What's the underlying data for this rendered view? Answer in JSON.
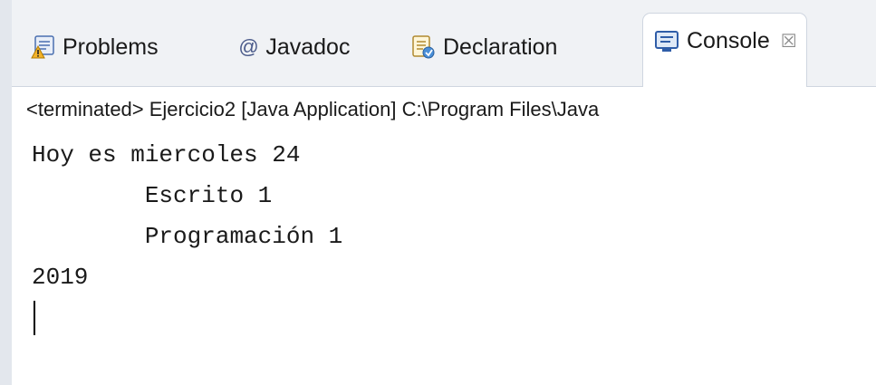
{
  "tabs": [
    {
      "label": "Problems",
      "icon": "problems-icon"
    },
    {
      "label": "Javadoc",
      "icon": "at-sign-icon",
      "glyph": "@"
    },
    {
      "label": "Declaration",
      "icon": "declaration-icon"
    },
    {
      "label": "Console",
      "icon": "console-icon",
      "active": true,
      "close_glyph": "☒"
    }
  ],
  "console": {
    "status_line": "<terminated> Ejercicio2 [Java Application] C:\\Program Files\\Java",
    "output": "Hoy es miercoles 24\n\tEscrito 1\n\tProgramación 1\n2019"
  },
  "colors": {
    "tabbar_bg": "#f0f2f5",
    "border": "#cfd6e0",
    "text": "#1a1a1a"
  }
}
